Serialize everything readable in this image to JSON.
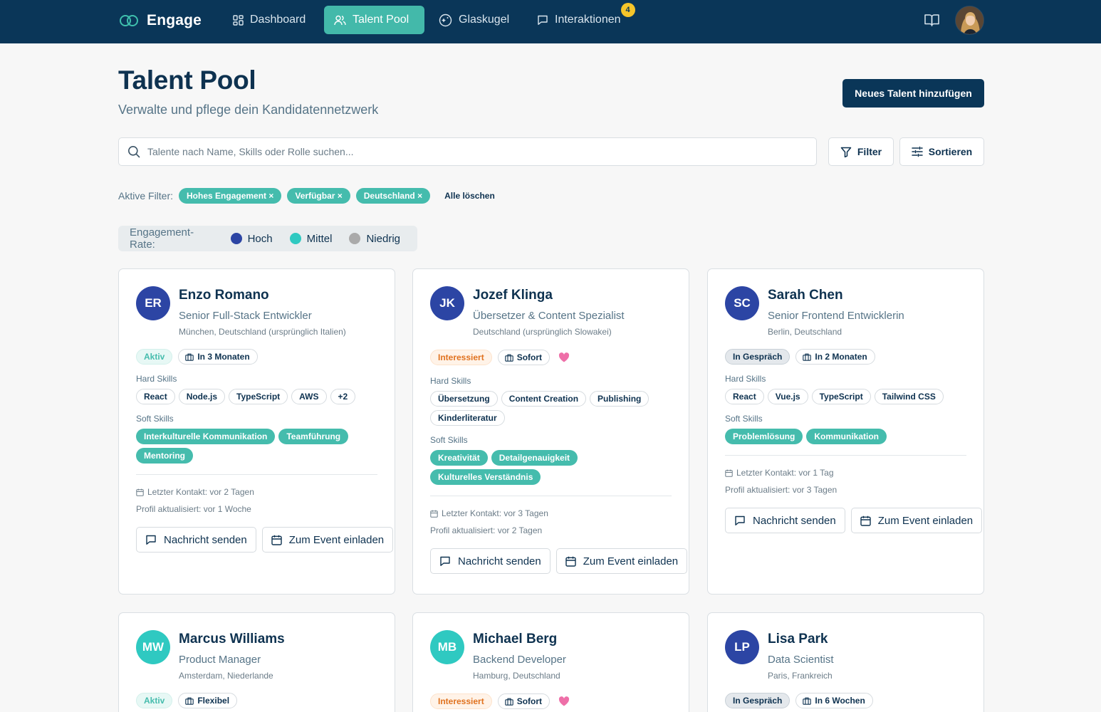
{
  "nav": {
    "brand": "Engage",
    "items": [
      {
        "label": "Dashboard"
      },
      {
        "label": "Talent Pool"
      },
      {
        "label": "Glaskugel"
      },
      {
        "label": "Interaktionen",
        "badge": "4"
      }
    ]
  },
  "header": {
    "title": "Talent Pool",
    "subtitle": "Verwalte und pflege dein Kandidatennetzwerk",
    "add_button": "Neues Talent hinzufügen"
  },
  "search": {
    "placeholder": "Talente nach Name, Skills oder Rolle suchen...",
    "filter_label": "Filter",
    "sort_label": "Sortieren"
  },
  "active_filters": {
    "label": "Aktive Filter:",
    "chips": [
      "Hohes Engagement ×",
      "Verfügbar ×",
      "Deutschland ×"
    ],
    "clear_label": "Alle löschen"
  },
  "legend": {
    "label": "Engagement-Rate:",
    "items": [
      {
        "label": "Hoch",
        "color": "#2c45a4"
      },
      {
        "label": "Mittel",
        "color": "#2fc9c1"
      },
      {
        "label": "Niedrig",
        "color": "#aaaaaa"
      }
    ]
  },
  "labels": {
    "hard_skills": "Hard Skills",
    "soft_skills": "Soft Skills",
    "message": "Nachricht senden",
    "invite": "Zum Event einladen"
  },
  "colors": {
    "navy": "#0a3658",
    "teal": "#45bcad",
    "engagement_high": "#2c45a4",
    "engagement_mid": "#2fc9c1"
  },
  "cards": [
    {
      "initials": "ER",
      "name": "Enzo Romano",
      "role": "Senior Full-Stack Entwickler",
      "location": "München, Deutschland (ursprünglich Italien)",
      "status": "Aktiv",
      "availability": "In 3 Monaten",
      "hard_skills": [
        "React",
        "Node.js",
        "TypeScript",
        "AWS",
        "+2"
      ],
      "soft_skills": [
        "Interkulturelle Kommunikation",
        "Teamführung",
        "Mentoring"
      ],
      "last_contact": "Letzter Kontakt: vor 2 Tagen",
      "profile_updated": "Profil aktualisiert: vor 1 Woche"
    },
    {
      "initials": "JK",
      "name": "Jozef Klinga",
      "role": "Übersetzer & Content Spezialist",
      "location": "Deutschland (ursprünglich Slowakei)",
      "status": "Interessiert",
      "availability": "Sofort",
      "hard_skills": [
        "Übersetzung",
        "Content Creation",
        "Publishing",
        "Kinderliteratur"
      ],
      "soft_skills": [
        "Kreativität",
        "Detailgenauigkeit",
        "Kulturelles Verständnis"
      ],
      "last_contact": "Letzter Kontakt: vor 3 Tagen",
      "profile_updated": "Profil aktualisiert: vor 2 Tagen"
    },
    {
      "initials": "SC",
      "name": "Sarah Chen",
      "role": "Senior Frontend Entwicklerin",
      "location": "Berlin, Deutschland",
      "status": "In Gespräch",
      "availability": "In 2 Monaten",
      "hard_skills": [
        "React",
        "Vue.js",
        "TypeScript",
        "Tailwind CSS"
      ],
      "soft_skills": [
        "Problemlösung",
        "Kommunikation"
      ],
      "last_contact": "Letzter Kontakt: vor 1 Tag",
      "profile_updated": "Profil aktualisiert: vor 3 Tagen"
    },
    {
      "initials": "MW",
      "name": "Marcus Williams",
      "role": "Product Manager",
      "location": "Amsterdam, Niederlande",
      "status": "Aktiv",
      "availability": "Flexibel"
    },
    {
      "initials": "MB",
      "name": "Michael Berg",
      "role": "Backend Developer",
      "location": "Hamburg, Deutschland",
      "status": "Interessiert",
      "availability": "Sofort"
    },
    {
      "initials": "LP",
      "name": "Lisa Park",
      "role": "Data Scientist",
      "location": "Paris, Frankreich",
      "status": "In Gespräch",
      "availability": "In 6 Wochen"
    }
  ]
}
